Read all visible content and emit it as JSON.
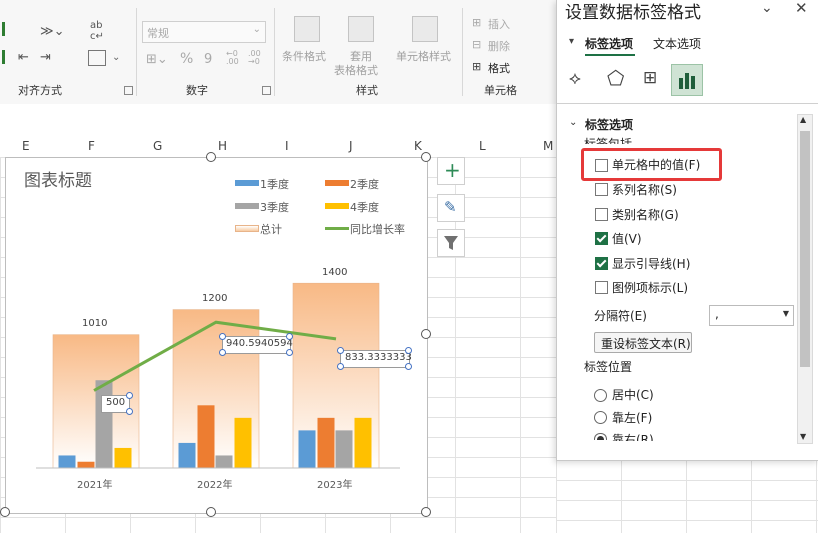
{
  "ribbon": {
    "alignment_label": "对齐方式",
    "number_label": "数字",
    "styles_label": "样式",
    "cells_label": "单元格",
    "number_format": "常规",
    "percent": "%",
    "comma": "9",
    "cond_format": "条件格式",
    "table_format_1": "套用",
    "table_format_2": "表格格式",
    "cell_style": "单元格样式",
    "insert": "插入",
    "delete": "删除",
    "format": "格式"
  },
  "columns": [
    "E",
    "F",
    "G",
    "H",
    "I",
    "J",
    "K",
    "L",
    "M"
  ],
  "chart": {
    "title": "图表标题",
    "legend": [
      "1季度",
      "2季度",
      "3季度",
      "4季度",
      "总计",
      "同比增长率"
    ],
    "colors": {
      "q1": "#5b9bd5",
      "q2": "#ed7d31",
      "q3": "#a5a5a5",
      "q4": "#ffc000",
      "line": "#70ad47"
    },
    "total_labels": [
      "1010",
      "1200",
      "1400"
    ],
    "categories": [
      "2021年",
      "2022年",
      "2023年"
    ],
    "growth_labels": [
      "500",
      "940.5940594",
      "833.3333333"
    ]
  },
  "chart_data": {
    "type": "bar",
    "categories": [
      "2021年",
      "2022年",
      "2023年"
    ],
    "series": [
      {
        "name": "1季度",
        "values": [
          100,
          200,
          300
        ]
      },
      {
        "name": "2季度",
        "values": [
          50,
          500,
          400
        ]
      },
      {
        "name": "3季度",
        "values": [
          700,
          100,
          300
        ]
      },
      {
        "name": "4季度",
        "values": [
          160,
          400,
          400
        ]
      },
      {
        "name": "总计",
        "values": [
          1010,
          1200,
          1400
        ]
      },
      {
        "name": "同比增长率",
        "values": [
          500,
          940.5940594,
          833.3333333
        ]
      }
    ]
  },
  "pane": {
    "title": "设置数据标签格式",
    "tab_label_options": "标签选项",
    "tab_text_options": "文本选项",
    "section_label_options": "标签选项",
    "label_contains": "标签包括",
    "options": [
      {
        "label": "单元格中的值(F)",
        "checked": false
      },
      {
        "label": "系列名称(S)",
        "checked": false
      },
      {
        "label": "类别名称(G)",
        "checked": false
      },
      {
        "label": "值(V)",
        "checked": true
      },
      {
        "label": "显示引导线(H)",
        "checked": true
      },
      {
        "label": "图例项标示(L)",
        "checked": false
      }
    ],
    "separator_label": "分隔符(E)",
    "separator_value": ",",
    "reset_button": "重设标签文本(R)",
    "label_position": "标签位置",
    "positions": [
      {
        "label": "居中(C)",
        "selected": false
      },
      {
        "label": "靠左(F)",
        "selected": false
      },
      {
        "label": "靠右(R)",
        "selected": true
      }
    ]
  }
}
